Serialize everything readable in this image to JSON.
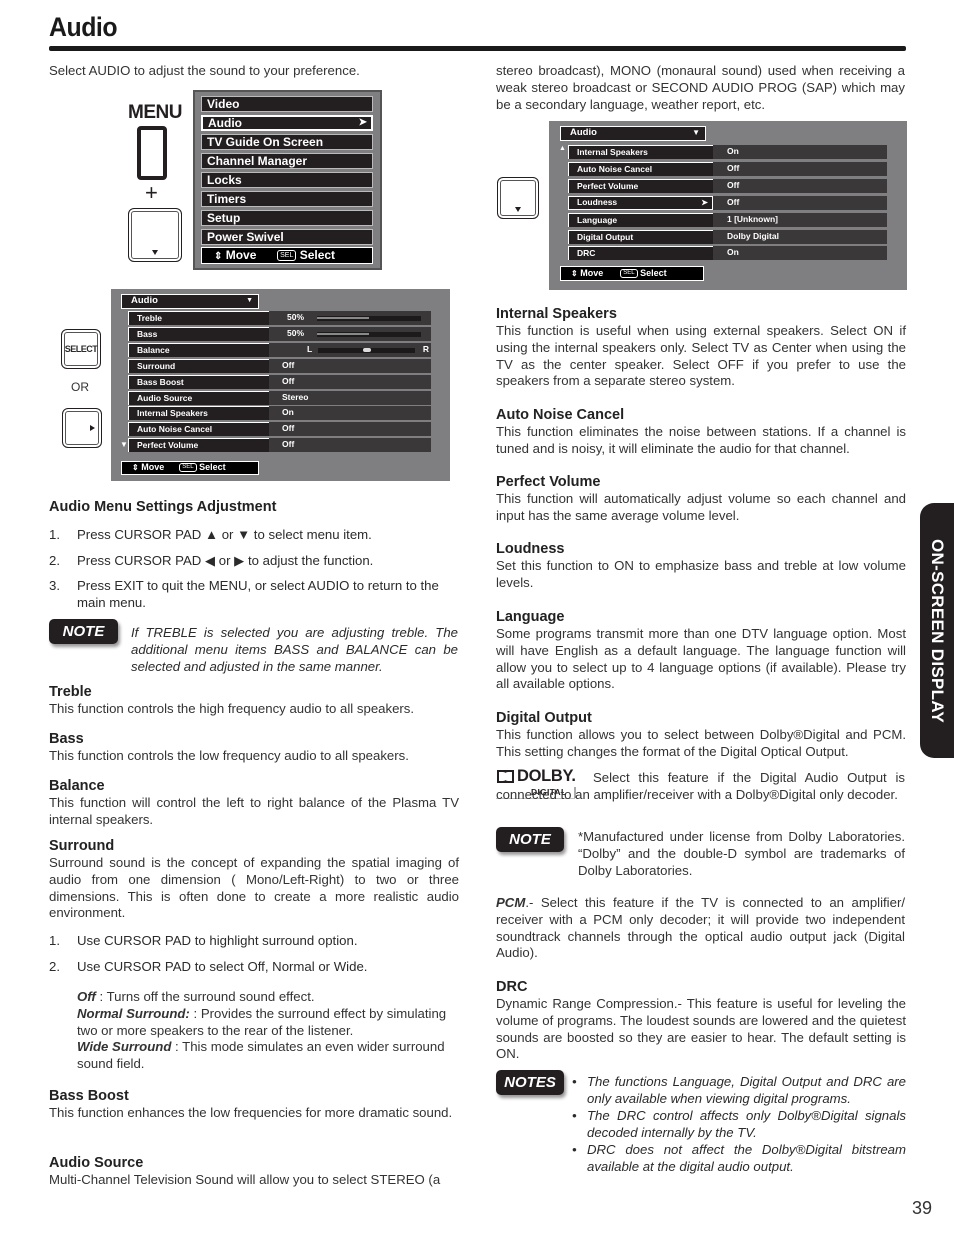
{
  "page": {
    "title": "Audio",
    "side_tab": "ON-SCREEN DISPLAY",
    "page_number": "39"
  },
  "intro": "Select AUDIO to adjust the sound to your preference.",
  "remote": {
    "menu_label": "MENU",
    "plus": "+",
    "select_label": "SELECT",
    "or_label": "OR"
  },
  "main_menu": {
    "items": [
      {
        "label": "Video"
      },
      {
        "label": "Audio",
        "selected": true,
        "chevron": "➤"
      },
      {
        "label": "TV Guide On Screen"
      },
      {
        "label": "Channel Manager"
      },
      {
        "label": "Locks"
      },
      {
        "label": "Timers"
      },
      {
        "label": "Setup"
      },
      {
        "label": "Power Swivel"
      }
    ],
    "footer": {
      "move_icon": "⇕",
      "move": "Move",
      "sel_key": "SEL",
      "select": "Select"
    }
  },
  "audio_menu_1": {
    "header": "Audio",
    "header_icon": "▼",
    "scroll_down_icon": "▼",
    "rows": [
      {
        "label": "Treble",
        "value": "50%",
        "level": 0.5,
        "type": "slider"
      },
      {
        "label": "Bass",
        "value": "50%",
        "level": 0.5,
        "type": "slider"
      },
      {
        "label": "Balance",
        "left": "L",
        "right": "R",
        "level": 0.5,
        "type": "balance"
      },
      {
        "label": "Surround",
        "value": "Off"
      },
      {
        "label": "Bass Boost",
        "value": "Off"
      },
      {
        "label": "Audio Source",
        "value": "Stereo"
      },
      {
        "label": "Internal Speakers",
        "value": "On"
      },
      {
        "label": "Auto Noise Cancel",
        "value": "Off"
      },
      {
        "label": "Perfect Volume",
        "value": "Off"
      }
    ],
    "footer": {
      "move": "Move",
      "sel_key": "SEL",
      "select": "Select"
    }
  },
  "audio_menu_2": {
    "header": "Audio",
    "header_icon": "▼",
    "scroll_up_icon": "▲",
    "rows": [
      {
        "label": "Internal Speakers",
        "value": "On"
      },
      {
        "label": "Auto Noise Cancel",
        "value": "Off"
      },
      {
        "label": "Perfect Volume",
        "value": "Off"
      },
      {
        "label": "Loudness",
        "value": "Off",
        "selected": true,
        "chevron": "➤"
      },
      {
        "label": "Language",
        "value": "1 [Unknown]"
      },
      {
        "label": "Digital Output",
        "value": "Dolby Digital"
      },
      {
        "label": "DRC",
        "value": "On"
      }
    ],
    "footer": {
      "move": "Move",
      "sel_key": "SEL",
      "select": "Select"
    }
  },
  "left": {
    "adjust_heading": "Audio Menu Settings Adjustment",
    "steps": [
      {
        "num": "1.",
        "text": "Press CURSOR PAD ▲ or ▼ to select menu item."
      },
      {
        "num": "2.",
        "text": "Press CURSOR PAD  ◀ or ▶ to adjust the function."
      },
      {
        "num": "3.",
        "text": "Press EXIT to quit the MENU, or select AUDIO to return to the main menu."
      }
    ],
    "note_badge": "NOTE",
    "note_text": "If TREBLE is selected you are adjusting treble. The additional menu items BASS and BALANCE can be selected and adjusted in the same manner.",
    "treble": {
      "heading": "Treble",
      "body": "This function controls the high frequency audio to all speakers."
    },
    "bass": {
      "heading": "Bass",
      "body": "This function controls the low frequency audio to all speakers."
    },
    "balance": {
      "heading": "Balance",
      "body": "This function will control the left to right balance of the Plasma TV internal speakers."
    },
    "surround": {
      "heading": "Surround",
      "body": "Surround sound is the concept of expanding the spatial imaging of audio from one dimension ( Mono/Left-Right) to two or three dimensions. This is often done to create a more realistic audio environment.",
      "steps": [
        {
          "num": "1.",
          "text": "Use CURSOR PAD to highlight surround option."
        },
        {
          "num": "2.",
          "text": "Use CURSOR PAD to select Off, Normal or Wide."
        }
      ],
      "off_term": "Off",
      "off_desc": " : Turns off the surround sound effect.",
      "normal_term": "Normal Surround:",
      "normal_desc": " : Provides the surround effect by simulating two or more speakers to the rear of the listener.",
      "wide_term": "Wide Surround",
      "wide_desc": " : This mode simulates an even wider surround sound field."
    },
    "bass_boost": {
      "heading": "Bass Boost",
      "body": "This function enhances the low frequencies for more dramatic sound."
    },
    "audio_source": {
      "heading": "Audio Source",
      "body": "Multi-Channel Television Sound will allow you to select STEREO (a"
    }
  },
  "right": {
    "continuation": "stereo broadcast), MONO (monaural sound) used when receiving a weak stereo broadcast or SECOND AUDIO PROG (SAP) which may be a secondary language, weather report, etc.",
    "internal_speakers": {
      "heading": "Internal Speakers",
      "body": "This function is useful when using external speakers. Select ON if using the internal speakers only. Select TV as Center when using the TV as the center speaker. Select OFF if you prefer to use the speakers from a separate stereo system."
    },
    "auto_noise": {
      "heading": "Auto Noise Cancel",
      "body": "This function eliminates the noise between stations. If a channel is tuned and is noisy, it will eliminate the audio for that channel."
    },
    "perfect_volume": {
      "heading": "Perfect Volume",
      "body": "This function will automatically adjust volume so each channel and input has the same average volume level."
    },
    "loudness": {
      "heading": "Loudness",
      "body": "Set this function to ON to emphasize bass and treble at low volume levels."
    },
    "language": {
      "heading": "Language",
      "body": "Some programs transmit more than one DTV language option. Most will have English as a default language. The language function will allow you to select up to 4 language options (if available). Please try all available options."
    },
    "digital_output": {
      "heading": "Digital Output",
      "body": "This function allows you to select between Dolby®Digital and PCM. This setting changes the format of the Digital Optical Output."
    },
    "dolby_logo": {
      "word": "DOLBY.",
      "sub": "DIGITAL"
    },
    "dolby_text": "Select this feature if the Digital Audio Output is connected to an amplifier/receiver with a Dolby®Digital only decoder.",
    "note_badge": "NOTE",
    "note_text": "*Manufactured under license from Dolby Laboratories. “Dolby” and the double-D symbol are trademarks of Dolby Laboratories.",
    "pcm_term": "PCM",
    "pcm_text": ".- Select this feature if the TV is connected to an amplifier/ receiver with a PCM only decoder; it will provide two independent soundtrack channels through the optical audio output jack (Digital Audio).",
    "drc": {
      "heading": "DRC",
      "body": "Dynamic Range Compression.- This feature is useful for leveling the volume of programs. The loudest sounds are lowered and the quietest sounds are boosted so they are easier to hear. The default setting is ON."
    },
    "notes_badge": "NOTES",
    "notes": [
      "The functions Language, Digital Output and DRC are only available when viewing digital programs.",
      "The DRC control affects only Dolby®Digital signals decoded internally by the TV.",
      "DRC does not affect the Dolby®Digital bitstream available at the digital audio output."
    ]
  }
}
